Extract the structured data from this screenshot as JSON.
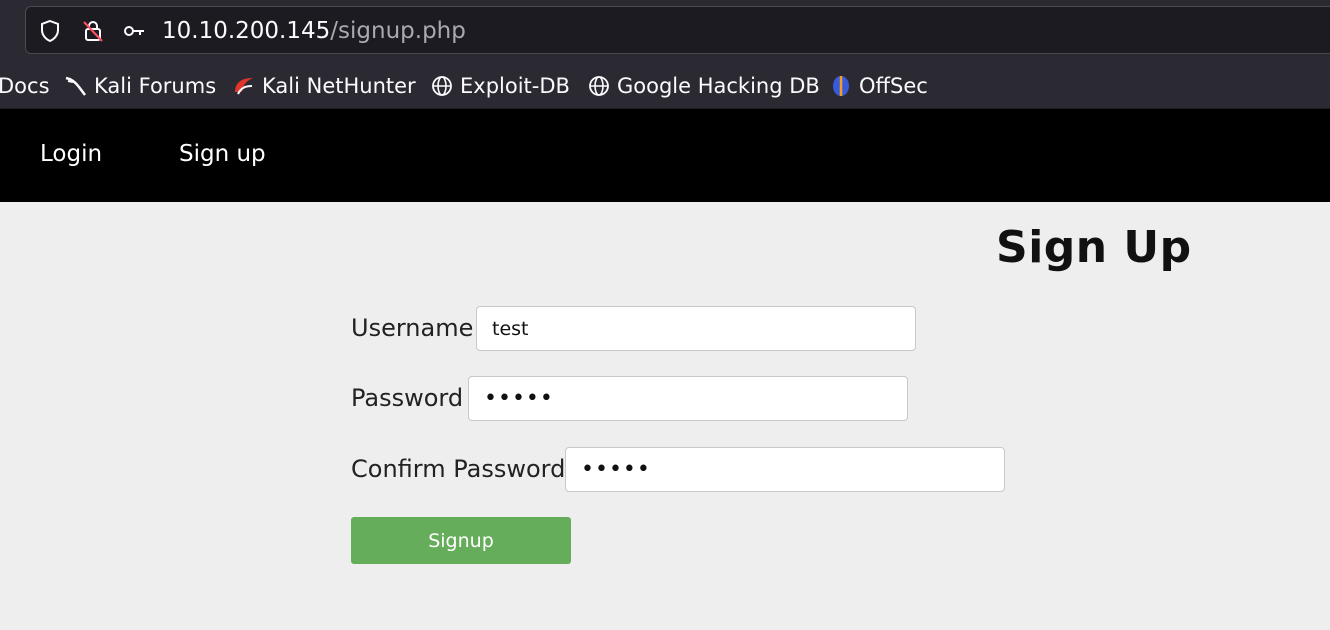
{
  "browser": {
    "url_host": "10.10.200.145",
    "url_path": "/signup.php",
    "bookmarks": [
      {
        "label": "Docs",
        "icon": "none"
      },
      {
        "label": "Kali Forums",
        "icon": "kali-dragon-icon"
      },
      {
        "label": "Kali NetHunter",
        "icon": "nethunter-icon"
      },
      {
        "label": "Exploit-DB",
        "icon": "globe-icon"
      },
      {
        "label": "Google Hacking DB",
        "icon": "globe-icon"
      },
      {
        "label": "OffSec",
        "icon": "offsec-icon"
      }
    ]
  },
  "nav": {
    "login": "Login",
    "signup": "Sign up"
  },
  "main": {
    "title": "Sign Up",
    "username_label": "Username",
    "username_value": "test",
    "password_label": "Password",
    "password_value": "•••••",
    "confirm_label": "Confirm Password",
    "confirm_value": "•••••",
    "submit_label": "Signup"
  },
  "colors": {
    "navbar": "#000000",
    "page_bg": "#eeeeee",
    "button": "#66ad5b",
    "chrome": "#2b2a33"
  }
}
